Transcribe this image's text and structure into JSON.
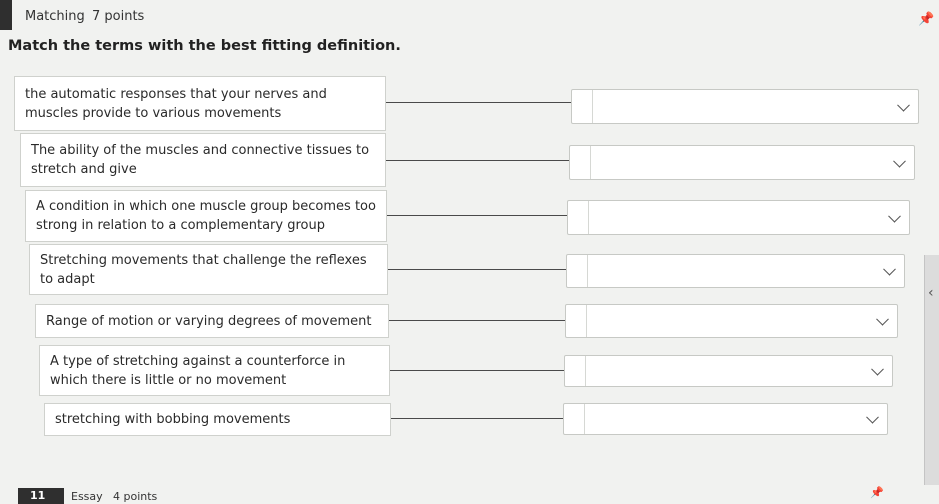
{
  "question": {
    "type": "Matching",
    "points": "7 points",
    "prompt": "Match the terms with the best fitting definition.",
    "pin_icon": "pin-icon"
  },
  "terms": [
    "the automatic responses that your nerves and muscles provide to various movements",
    "The ability of the muscles and connective tissues to stretch and give",
    "A condition in which one muscle group becomes too strong in relation to a complementary group",
    "Stretching movements that challenge the reflexes to adapt",
    "Range of motion or varying degrees of movement",
    "A type of stretching against a counterforce in which there is little or no movement",
    "stretching with bobbing movements"
  ],
  "next_question": {
    "number": "11",
    "type": "Essay",
    "points": "4 points"
  }
}
